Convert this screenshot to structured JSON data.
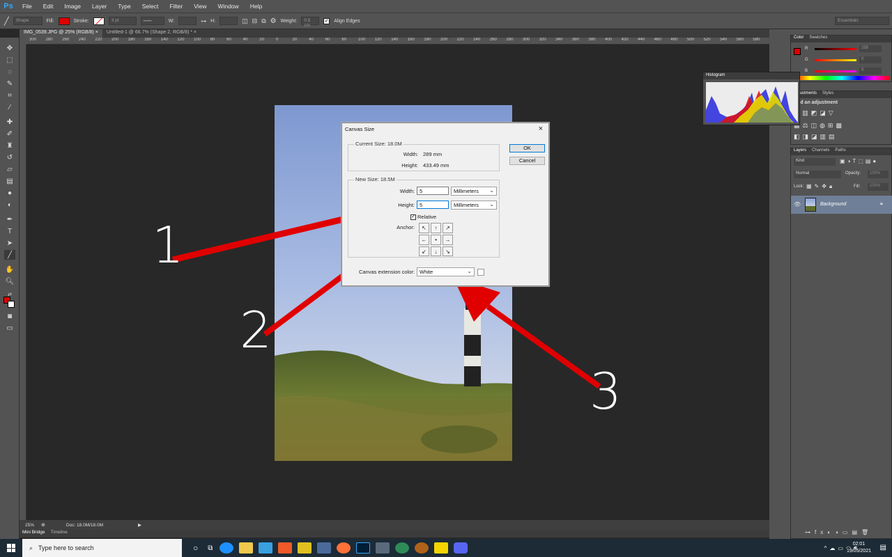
{
  "app": {
    "logo": "Ps"
  },
  "menu": [
    "File",
    "Edit",
    "Image",
    "Layer",
    "Type",
    "Select",
    "Filter",
    "View",
    "Window",
    "Help"
  ],
  "options_bar": {
    "tool_mode": "Shape",
    "fill_label": "Fill:",
    "stroke_label": "Stroke:",
    "stroke_width": "3 pt",
    "w_label": "W:",
    "h_label": "H:",
    "weight_label": "Weight:",
    "weight_value": "0.5 cm",
    "align_edges": "Align Edges",
    "workspace": "Essentials",
    "fill_color": "#e00000"
  },
  "doc_tabs": [
    {
      "label": "IMG_0539.JPG @ 25% (RGB/8) ×",
      "active": true
    },
    {
      "label": "Untitled-1 @ 66.7% (Shape 2, RGB/8) * ×",
      "active": false
    }
  ],
  "ruler_labels": [
    "300",
    "280",
    "260",
    "240",
    "220",
    "200",
    "180",
    "160",
    "140",
    "120",
    "100",
    "80",
    "60",
    "40",
    "20",
    "0",
    "20",
    "40",
    "60",
    "80",
    "100",
    "120",
    "140",
    "160",
    "180",
    "200",
    "220",
    "240",
    "260",
    "280",
    "300",
    "320",
    "340",
    "360",
    "380",
    "400",
    "420",
    "440",
    "460",
    "480",
    "500",
    "520",
    "540",
    "560",
    "580"
  ],
  "status": {
    "zoom": "25%",
    "doc": "Doc: 18.0M/18.0M"
  },
  "bottom_tabs": [
    "Mini Bridge",
    "Timeline"
  ],
  "panels": {
    "color_tabs": [
      "Color",
      "Swatches"
    ],
    "color_values": {
      "r": "255",
      "g": "0",
      "b": "0"
    },
    "histogram_title": "Histogram",
    "adjust_tabs": [
      "Adjustments",
      "Styles"
    ],
    "adjust_title": "Add an adjustment",
    "layers_tabs": [
      "Layers",
      "Channels",
      "Paths"
    ],
    "kind": "Kind",
    "blend_mode": "Normal",
    "opacity_label": "Opacity:",
    "opacity_value": "100%",
    "lock_label": "Lock:",
    "fill_label": "Fill:",
    "fill_value": "100%",
    "layer_name": "Background",
    "histo_zoom": "25%"
  },
  "dialog": {
    "title": "Canvas Size",
    "current_legend": "Current Size: 18.0M",
    "current_width_label": "Width:",
    "current_width": "289 mm",
    "current_height_label": "Height:",
    "current_height": "433.49 mm",
    "new_legend": "New Size: 18.5M",
    "width_label": "Width:",
    "width_value": "5",
    "width_unit": "Millimeters",
    "height_label": "Height:",
    "height_value": "5",
    "height_unit": "Millimeters",
    "relative_label": "Relative",
    "anchor_label": "Anchor:",
    "extension_label": "Canvas extension color:",
    "extension_value": "White",
    "ok": "OK",
    "cancel": "Cancel"
  },
  "annotations": [
    "1",
    "2",
    "3"
  ],
  "taskbar": {
    "search_placeholder": "Type here to search",
    "time": "02:01",
    "date": "19/05/2021"
  }
}
